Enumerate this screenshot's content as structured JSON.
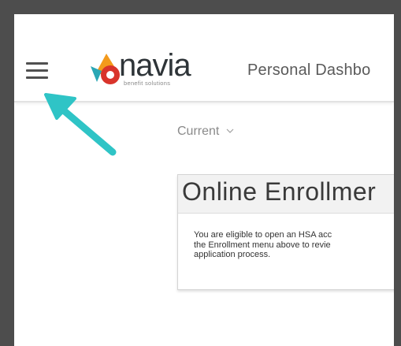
{
  "header": {
    "logo": {
      "word": "navia",
      "tagline": "benefit solutions"
    },
    "page_title": "Personal Dashbo"
  },
  "main": {
    "period_select": {
      "value": "Current"
    },
    "enrollment_card": {
      "title": "Online Enrollmer",
      "body_lines": [
        "You are eligible to open an HSA acc",
        "the Enrollment menu above to revie",
        "application process."
      ]
    }
  },
  "colors": {
    "arrow": "#2fc4c6",
    "logo_red": "#d9342b",
    "logo_orange": "#f39a1c",
    "logo_teal": "#2aa7b5",
    "frame": "#4d4d4d"
  },
  "icons": [
    "hamburger-menu-icon",
    "chevron-down-icon",
    "annotation-arrow-icon"
  ]
}
